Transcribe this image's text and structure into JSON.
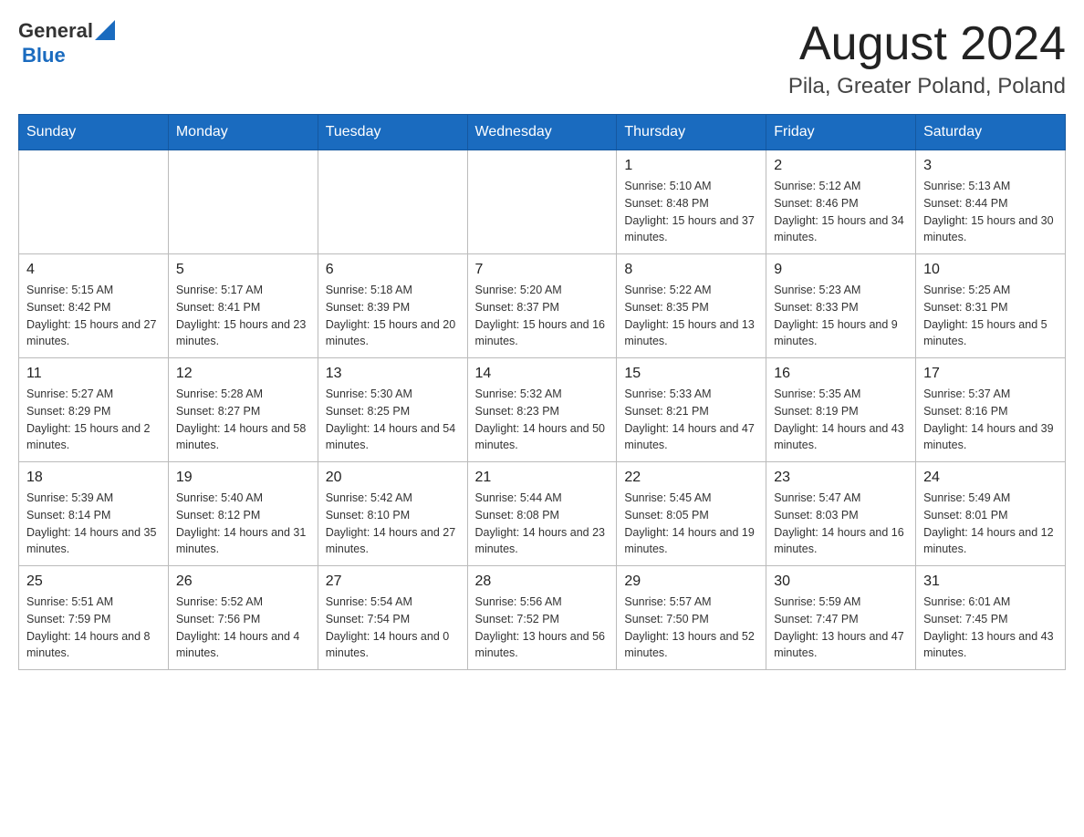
{
  "header": {
    "logo": {
      "general": "General",
      "blue": "Blue"
    },
    "title": "August 2024",
    "location": "Pila, Greater Poland, Poland"
  },
  "days_of_week": [
    "Sunday",
    "Monday",
    "Tuesday",
    "Wednesday",
    "Thursday",
    "Friday",
    "Saturday"
  ],
  "weeks": [
    [
      {
        "day": "",
        "info": ""
      },
      {
        "day": "",
        "info": ""
      },
      {
        "day": "",
        "info": ""
      },
      {
        "day": "",
        "info": ""
      },
      {
        "day": "1",
        "info": "Sunrise: 5:10 AM\nSunset: 8:48 PM\nDaylight: 15 hours and 37 minutes."
      },
      {
        "day": "2",
        "info": "Sunrise: 5:12 AM\nSunset: 8:46 PM\nDaylight: 15 hours and 34 minutes."
      },
      {
        "day": "3",
        "info": "Sunrise: 5:13 AM\nSunset: 8:44 PM\nDaylight: 15 hours and 30 minutes."
      }
    ],
    [
      {
        "day": "4",
        "info": "Sunrise: 5:15 AM\nSunset: 8:42 PM\nDaylight: 15 hours and 27 minutes."
      },
      {
        "day": "5",
        "info": "Sunrise: 5:17 AM\nSunset: 8:41 PM\nDaylight: 15 hours and 23 minutes."
      },
      {
        "day": "6",
        "info": "Sunrise: 5:18 AM\nSunset: 8:39 PM\nDaylight: 15 hours and 20 minutes."
      },
      {
        "day": "7",
        "info": "Sunrise: 5:20 AM\nSunset: 8:37 PM\nDaylight: 15 hours and 16 minutes."
      },
      {
        "day": "8",
        "info": "Sunrise: 5:22 AM\nSunset: 8:35 PM\nDaylight: 15 hours and 13 minutes."
      },
      {
        "day": "9",
        "info": "Sunrise: 5:23 AM\nSunset: 8:33 PM\nDaylight: 15 hours and 9 minutes."
      },
      {
        "day": "10",
        "info": "Sunrise: 5:25 AM\nSunset: 8:31 PM\nDaylight: 15 hours and 5 minutes."
      }
    ],
    [
      {
        "day": "11",
        "info": "Sunrise: 5:27 AM\nSunset: 8:29 PM\nDaylight: 15 hours and 2 minutes."
      },
      {
        "day": "12",
        "info": "Sunrise: 5:28 AM\nSunset: 8:27 PM\nDaylight: 14 hours and 58 minutes."
      },
      {
        "day": "13",
        "info": "Sunrise: 5:30 AM\nSunset: 8:25 PM\nDaylight: 14 hours and 54 minutes."
      },
      {
        "day": "14",
        "info": "Sunrise: 5:32 AM\nSunset: 8:23 PM\nDaylight: 14 hours and 50 minutes."
      },
      {
        "day": "15",
        "info": "Sunrise: 5:33 AM\nSunset: 8:21 PM\nDaylight: 14 hours and 47 minutes."
      },
      {
        "day": "16",
        "info": "Sunrise: 5:35 AM\nSunset: 8:19 PM\nDaylight: 14 hours and 43 minutes."
      },
      {
        "day": "17",
        "info": "Sunrise: 5:37 AM\nSunset: 8:16 PM\nDaylight: 14 hours and 39 minutes."
      }
    ],
    [
      {
        "day": "18",
        "info": "Sunrise: 5:39 AM\nSunset: 8:14 PM\nDaylight: 14 hours and 35 minutes."
      },
      {
        "day": "19",
        "info": "Sunrise: 5:40 AM\nSunset: 8:12 PM\nDaylight: 14 hours and 31 minutes."
      },
      {
        "day": "20",
        "info": "Sunrise: 5:42 AM\nSunset: 8:10 PM\nDaylight: 14 hours and 27 minutes."
      },
      {
        "day": "21",
        "info": "Sunrise: 5:44 AM\nSunset: 8:08 PM\nDaylight: 14 hours and 23 minutes."
      },
      {
        "day": "22",
        "info": "Sunrise: 5:45 AM\nSunset: 8:05 PM\nDaylight: 14 hours and 19 minutes."
      },
      {
        "day": "23",
        "info": "Sunrise: 5:47 AM\nSunset: 8:03 PM\nDaylight: 14 hours and 16 minutes."
      },
      {
        "day": "24",
        "info": "Sunrise: 5:49 AM\nSunset: 8:01 PM\nDaylight: 14 hours and 12 minutes."
      }
    ],
    [
      {
        "day": "25",
        "info": "Sunrise: 5:51 AM\nSunset: 7:59 PM\nDaylight: 14 hours and 8 minutes."
      },
      {
        "day": "26",
        "info": "Sunrise: 5:52 AM\nSunset: 7:56 PM\nDaylight: 14 hours and 4 minutes."
      },
      {
        "day": "27",
        "info": "Sunrise: 5:54 AM\nSunset: 7:54 PM\nDaylight: 14 hours and 0 minutes."
      },
      {
        "day": "28",
        "info": "Sunrise: 5:56 AM\nSunset: 7:52 PM\nDaylight: 13 hours and 56 minutes."
      },
      {
        "day": "29",
        "info": "Sunrise: 5:57 AM\nSunset: 7:50 PM\nDaylight: 13 hours and 52 minutes."
      },
      {
        "day": "30",
        "info": "Sunrise: 5:59 AM\nSunset: 7:47 PM\nDaylight: 13 hours and 47 minutes."
      },
      {
        "day": "31",
        "info": "Sunrise: 6:01 AM\nSunset: 7:45 PM\nDaylight: 13 hours and 43 minutes."
      }
    ]
  ]
}
